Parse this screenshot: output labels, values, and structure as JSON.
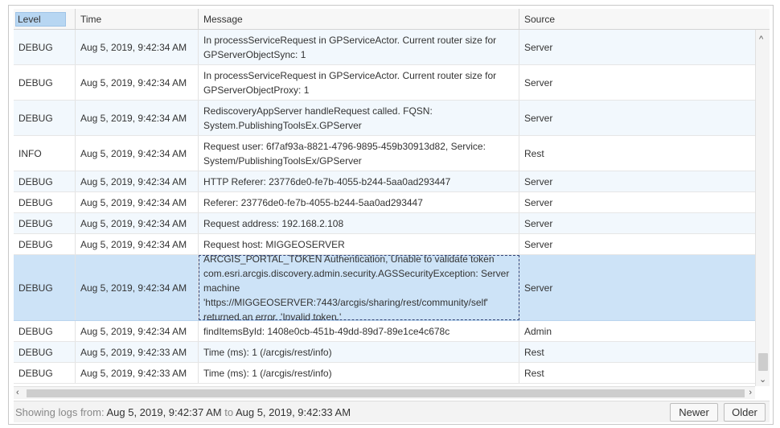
{
  "columns": {
    "level": "Level",
    "time": "Time",
    "message": "Message",
    "source": "Source"
  },
  "rows": [
    {
      "level": "DEBUG",
      "time": "Aug 5, 2019, 9:42:34 AM",
      "message": "In processServiceRequest in GPServiceActor. Current router size for GPServerObjectSync: 1",
      "source": "Server"
    },
    {
      "level": "DEBUG",
      "time": "Aug 5, 2019, 9:42:34 AM",
      "message": "In processServiceRequest in GPServiceActor. Current router size for GPServerObjectProxy: 1",
      "source": "Server"
    },
    {
      "level": "DEBUG",
      "time": "Aug 5, 2019, 9:42:34 AM",
      "message": "RediscoveryAppServer handleRequest called. FQSN: System.PublishingToolsEx.GPServer",
      "source": "Server"
    },
    {
      "level": "INFO",
      "time": "Aug 5, 2019, 9:42:34 AM",
      "message": "Request user: 6f7af93a-8821-4796-9895-459b30913d82, Service: System/PublishingToolsEx/GPServer",
      "source": "Rest"
    },
    {
      "level": "DEBUG",
      "time": "Aug 5, 2019, 9:42:34 AM",
      "message": "HTTP Referer: 23776de0-fe7b-4055-b244-5aa0ad293447",
      "source": "Server"
    },
    {
      "level": "DEBUG",
      "time": "Aug 5, 2019, 9:42:34 AM",
      "message": "Referer: 23776de0-fe7b-4055-b244-5aa0ad293447",
      "source": "Server"
    },
    {
      "level": "DEBUG",
      "time": "Aug 5, 2019, 9:42:34 AM",
      "message": "Request address: 192.168.2.108",
      "source": "Server"
    },
    {
      "level": "DEBUG",
      "time": "Aug 5, 2019, 9:42:34 AM",
      "message": "Request host: MIGGEOSERVER",
      "source": "Server"
    },
    {
      "level": "DEBUG",
      "time": "Aug 5, 2019, 9:42:34 AM",
      "message": "ARCGIS_PORTAL_TOKEN Authentication, Unable to validate token com.esri.arcgis.discovery.admin.security.AGSSecurityException: Server machine 'https://MIGGEOSERVER:7443/arcgis/sharing/rest/community/self' returned an error. 'Invalid token.'",
      "source": "Server"
    },
    {
      "level": "DEBUG",
      "time": "Aug 5, 2019, 9:42:34 AM",
      "message": "findItemsById: 1408e0cb-451b-49dd-89d7-89e1ce4c678c",
      "source": "Admin"
    },
    {
      "level": "DEBUG",
      "time": "Aug 5, 2019, 9:42:33 AM",
      "message": "Time (ms): 1 (/arcgis/rest/info)",
      "source": "Rest"
    },
    {
      "level": "DEBUG",
      "time": "Aug 5, 2019, 9:42:33 AM",
      "message": "Time (ms): 1 (/arcgis/rest/info)",
      "source": "Rest"
    }
  ],
  "footer": {
    "prefix": "Showing logs from:",
    "from": "Aug 5, 2019, 9:42:37 AM",
    "joiner": "to",
    "to": "Aug 5, 2019, 9:42:33 AM"
  },
  "buttons": {
    "newer": "Newer",
    "older": "Older"
  },
  "icons": {
    "scroll_up": "chevron-up-icon",
    "scroll_down": "chevron-down-icon",
    "scroll_left": "chevron-left-icon",
    "scroll_right": "chevron-right-icon"
  }
}
